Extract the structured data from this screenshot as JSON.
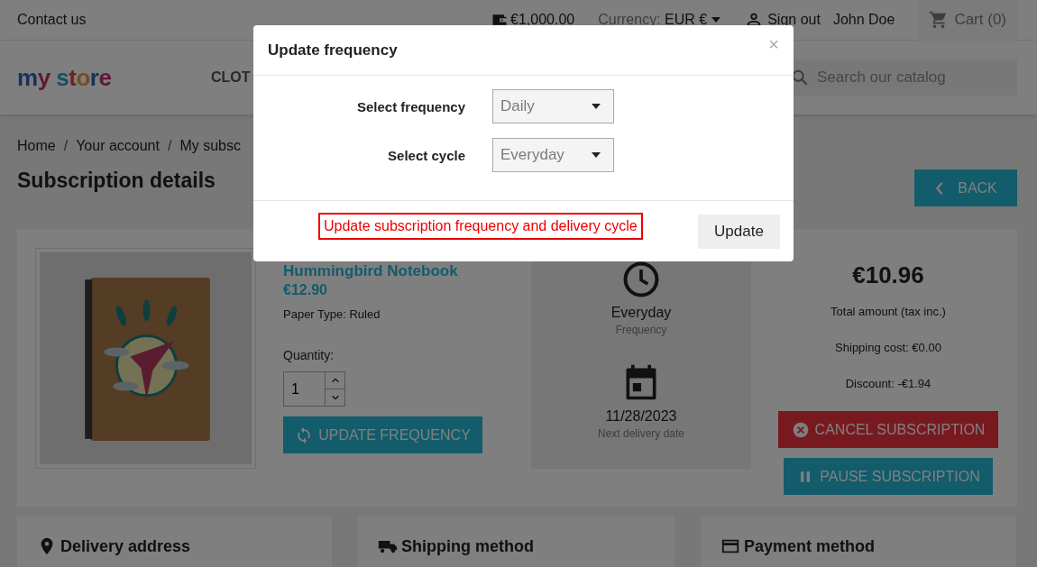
{
  "header": {
    "contact": "Contact us",
    "wallet": "€1,000.00",
    "currency_label": "Currency:",
    "currency": "EUR €",
    "sign_out": "Sign out",
    "user": "John Doe",
    "cart": "Cart (0)"
  },
  "nav": {
    "logo": "my store",
    "menu": [
      "CLOT"
    ],
    "search": {
      "placeholder": "Search our catalog"
    }
  },
  "breadcrumb": {
    "separator": "/",
    "items": [
      "Home",
      "Your account",
      "My subsc"
    ]
  },
  "page_title": "Subscription details",
  "back_button": "BACK",
  "product": {
    "name": "Hummingbird Notebook",
    "price": "€12.90",
    "attribute": "Paper Type: Ruled",
    "quantity_label": "Quantity:",
    "quantity": "1",
    "update_button": "UPDATE FREQUENCY"
  },
  "schedule": {
    "frequency": "Everyday",
    "frequency_label": "Frequency",
    "next_date": "11/28/2023",
    "next_date_label": "Next delivery date"
  },
  "totals": {
    "total": "€10.96",
    "total_label": "Total amount (tax inc.)",
    "shipping": "Shipping cost: €0.00",
    "discount": "Discount: -€1.94",
    "cancel_button": "CANCEL SUBSCRIPTION",
    "pause_button": "PAUSE SUBSCRIPTION"
  },
  "sections": [
    {
      "kind": "address",
      "title": "Delivery address"
    },
    {
      "kind": "shipping",
      "title": "Shipping method"
    },
    {
      "kind": "payment",
      "title": "Payment method"
    }
  ],
  "modal": {
    "title": "Update frequency",
    "close": "×",
    "fields": [
      {
        "label": "Select frequency",
        "value": "Daily"
      },
      {
        "label": "Select cycle",
        "value": "Everyday"
      }
    ],
    "note": "Update subscription frequency and delivery cycle",
    "submit": "Update"
  }
}
